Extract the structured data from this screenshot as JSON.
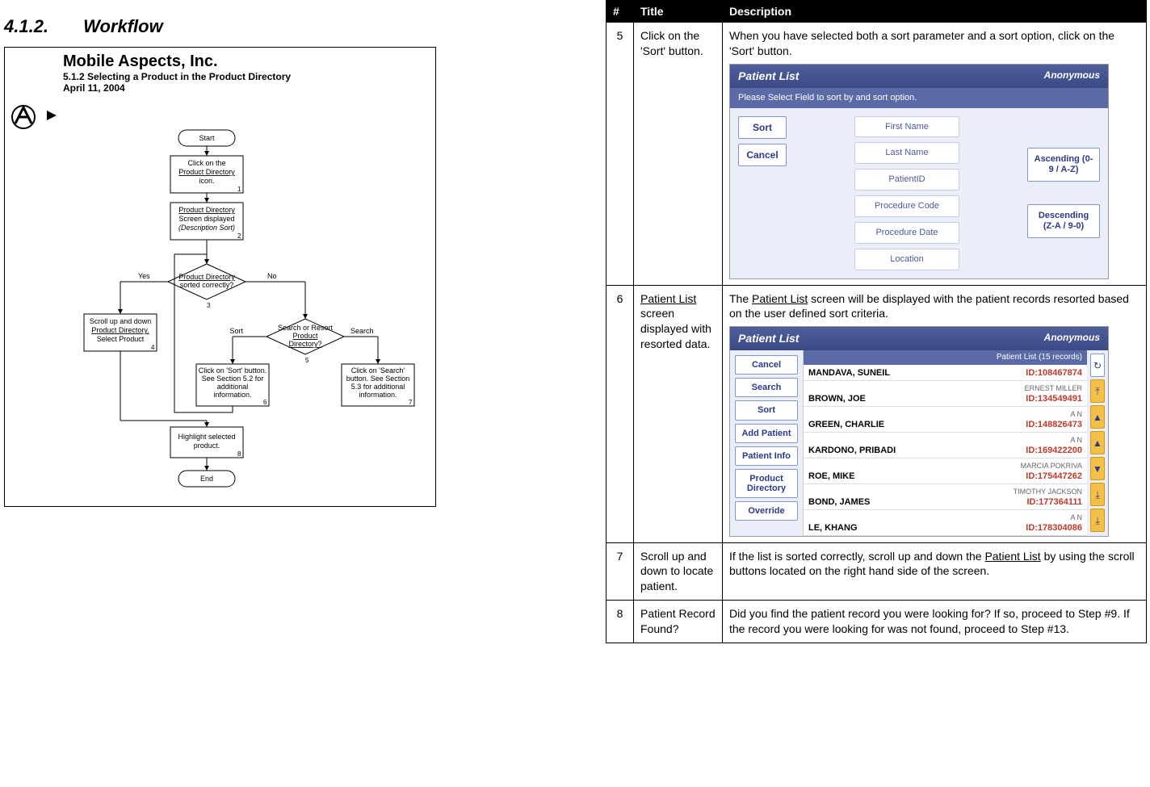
{
  "heading": {
    "number": "4.1.2.",
    "title": "Workflow"
  },
  "flowchart": {
    "company": "Mobile Aspects, Inc.",
    "subtitle": "5.1.2  Selecting a Product in the Product Directory",
    "date": "April 11, 2004",
    "nodes": {
      "start": "Start",
      "n1": {
        "l1": "Click on the",
        "l2": "Product Directory",
        "l3": "icon.",
        "num": "1"
      },
      "n2": {
        "l1": "Product Directory",
        "l2": "Screen displayed",
        "l3": "(Description Sort)",
        "num": "2"
      },
      "n3": {
        "l1": "Product Directory",
        "l2": "sorted correctly?",
        "num": "3"
      },
      "n4": {
        "l1": "Scroll up and down",
        "l2": "Product Directory.",
        "l3": "Select Product",
        "num": "4"
      },
      "n5": {
        "l1": "Search or Resort",
        "l2": "Product",
        "l3": "Directory?",
        "num": "5"
      },
      "n6": {
        "l1": "Click on 'Sort' button.",
        "l2": "See Section 5.2 for",
        "l3": "additional",
        "l4": "information.",
        "num": "6"
      },
      "n7": {
        "l1": "Click on 'Search'",
        "l2": "button.  See Section",
        "l3": "5.3 for additional",
        "l4": "information.",
        "num": "7"
      },
      "n8": {
        "l1": "Highlight selected",
        "l2": "product.",
        "num": "8"
      },
      "end": "End",
      "yes": "Yes",
      "no": "No",
      "sort": "Sort",
      "search": "Search"
    }
  },
  "table": {
    "headers": {
      "num": "#",
      "title": "Title",
      "desc": "Description"
    },
    "rows": [
      {
        "num": "5",
        "title": "Click on the 'Sort' button.",
        "desc_pre": "When you have selected both a sort parameter and a sort option, click on the 'Sort' button.",
        "shot": "sort"
      },
      {
        "num": "6",
        "title_seg": [
          {
            "t": "Patient List",
            "u": true
          },
          {
            "t": " screen displayed with resorted data."
          }
        ],
        "desc_seg": [
          {
            "t": "The "
          },
          {
            "t": "Patient List",
            "u": true
          },
          {
            "t": " screen will be displayed with the patient records resorted based on the user defined sort criteria."
          }
        ],
        "shot": "list"
      },
      {
        "num": "7",
        "title": "Scroll up and down to locate patient.",
        "desc_seg": [
          {
            "t": "If the list is sorted correctly, scroll up and down the "
          },
          {
            "t": "Patient List",
            "u": true
          },
          {
            "t": " by using the scroll buttons located on the right hand side of the screen."
          }
        ]
      },
      {
        "num": "8",
        "title": "Patient Record Found?",
        "desc_pre": "Did you find the patient record you were looking for?  If so, proceed to Step #9.  If the record you were looking for was not found, proceed to Step #13."
      }
    ]
  },
  "shot_sort": {
    "title": "Patient List",
    "anon": "Anonymous",
    "instruction": "Please Select Field to sort by and sort option.",
    "left_buttons": [
      "Sort",
      "Cancel"
    ],
    "fields": [
      "First Name",
      "Last Name",
      "PatientID",
      "Procedure Code",
      "Procedure Date",
      "Location"
    ],
    "asc": "Ascending (0-9 / A-Z)",
    "desc": "Descending (Z-A / 9-0)"
  },
  "shot_list": {
    "title": "Patient List",
    "anon": "Anonymous",
    "count": "Patient List (15 records)",
    "left_buttons": [
      "Cancel",
      "Search",
      "Sort",
      "Add Patient",
      "Patient Info",
      "Product Directory",
      "Override"
    ],
    "rows": [
      {
        "name": "MANDAVA, SUNEIL",
        "id": "ID:108467874",
        "extra": ""
      },
      {
        "name": "BROWN, JOE",
        "id": "ID:134549491",
        "extra": "ERNEST MILLER"
      },
      {
        "name": "GREEN, CHARLIE",
        "id": "ID:148826473",
        "extra": "A N"
      },
      {
        "name": "KARDONO, PRIBADI",
        "id": "ID:169422200",
        "extra": "A N"
      },
      {
        "name": "ROE, MIKE",
        "id": "ID:175447262",
        "extra": "MARCIA POKRIVA"
      },
      {
        "name": "BOND, JAMES",
        "id": "ID:177364111",
        "extra": "TIMOTHY JACKSON"
      },
      {
        "name": "LE, KHANG",
        "id": "ID:178304086",
        "extra": "A N"
      }
    ],
    "scroll": [
      "↻",
      "⤒",
      "▲",
      "▲",
      "▼",
      "⤓",
      "⤓"
    ]
  }
}
